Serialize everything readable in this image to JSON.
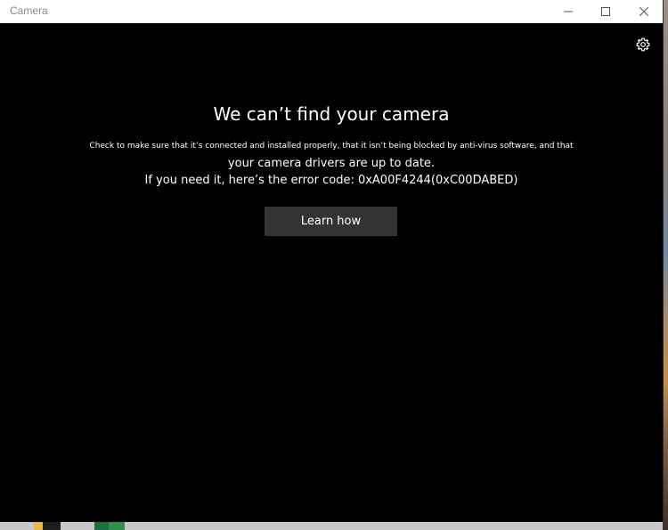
{
  "window": {
    "title": "Camera"
  },
  "titlebar_buttons": {
    "minimize_icon": "minimize-icon",
    "maximize_icon": "maximize-icon",
    "close_icon": "close-icon"
  },
  "settings": {
    "icon": "gear-icon"
  },
  "error": {
    "headline": "We can’t find your camera",
    "line1": "Check to make sure that it’s connected and installed properly, that it isn’t being blocked by anti-virus software, and that",
    "line2": "your camera drivers are up to date.",
    "line3": "If you need it, here’s the error code: 0xA00F4244(0xC00DABED)"
  },
  "actions": {
    "learn_label": "Learn how"
  },
  "colors": {
    "background": "#000000",
    "titlebar": "#ffffff",
    "button": "#333333",
    "text": "#ffffff"
  }
}
